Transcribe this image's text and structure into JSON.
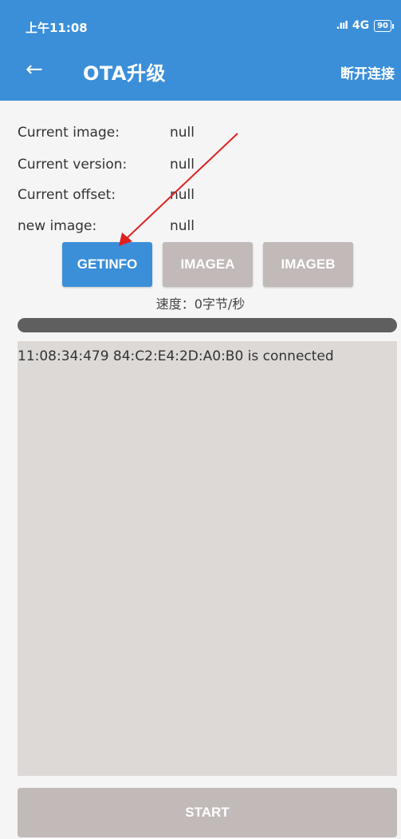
{
  "status_bar": {
    "time": "上午11:08",
    "signal_icon": "signal-icon",
    "network": "4G",
    "battery": "90"
  },
  "app_bar": {
    "back_icon": "←",
    "title": "OTA升级",
    "disconnect_label": "断开连接"
  },
  "info": {
    "rows": [
      {
        "label": "Current image:",
        "value": "null"
      },
      {
        "label": "Current version:",
        "value": "null"
      },
      {
        "label": "Current offset:",
        "value": "null"
      },
      {
        "label": "new image:",
        "value": "null"
      }
    ]
  },
  "buttons": {
    "getinfo": "GETINFO",
    "imagea": "IMAGEA",
    "imageb": "IMAGEB",
    "start": "START"
  },
  "speed_text": "速度：0字节/秒",
  "progress": {
    "value": 0
  },
  "log": {
    "lines": [
      "11:08:34:479  84:C2:E4:2D:A0:B0 is connected"
    ]
  },
  "colors": {
    "primary": "#3b8fd9",
    "disabled_button": "#c2b9b9",
    "log_background": "#ddd9d7",
    "annotation_arrow": "#e02020"
  }
}
